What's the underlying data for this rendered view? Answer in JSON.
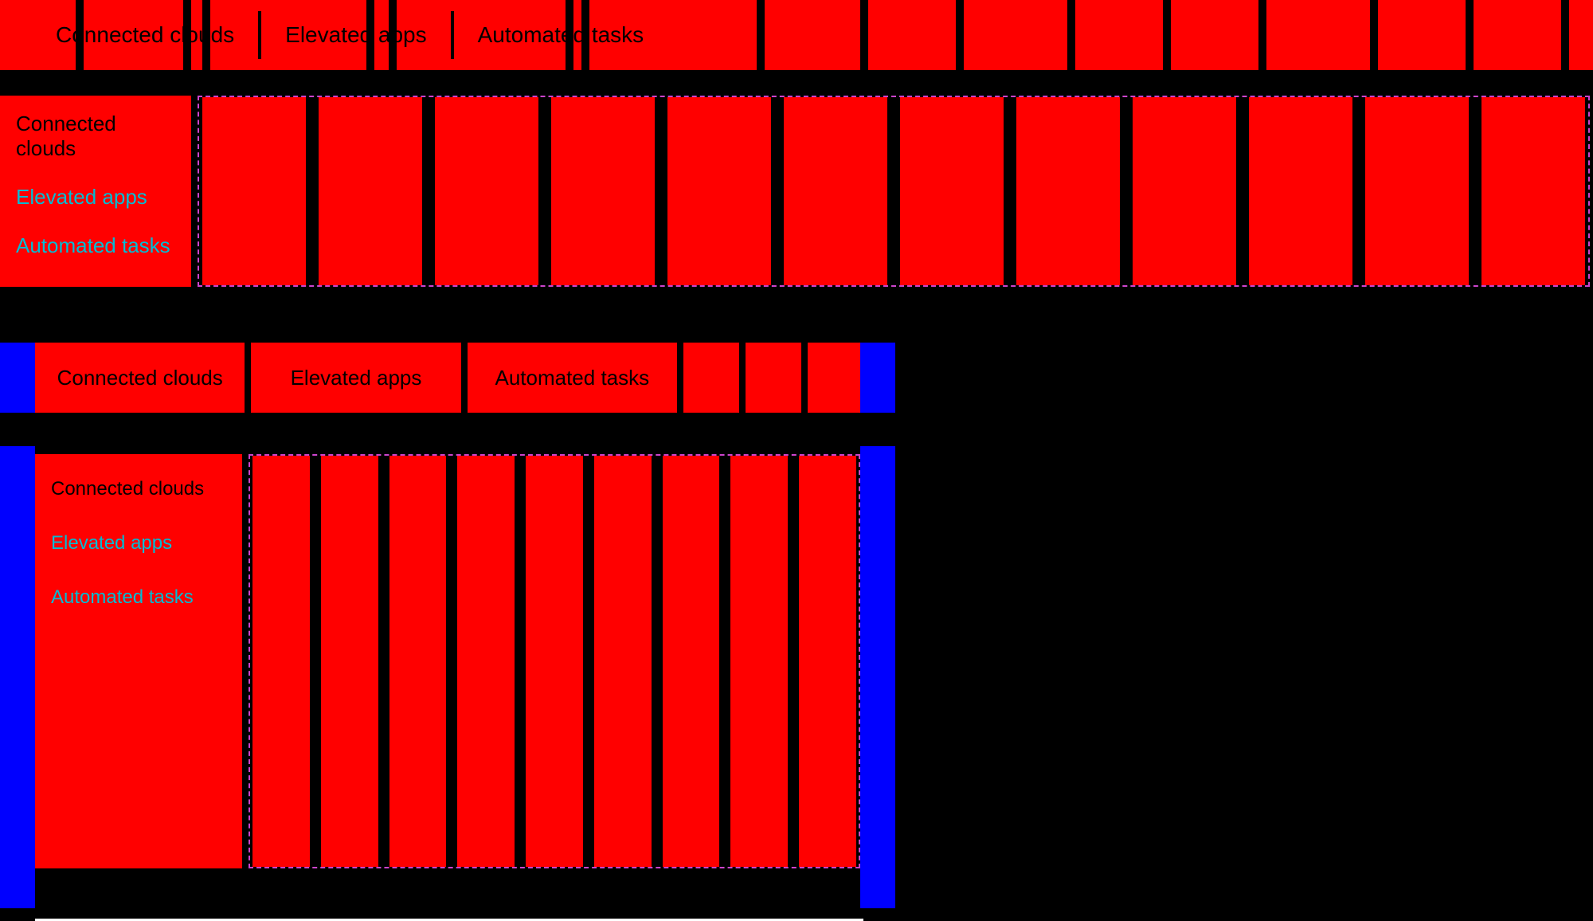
{
  "top_section": {
    "tabs": [
      {
        "label": "Connected clouds",
        "id": "connected-clouds"
      },
      {
        "label": "Elevated apps",
        "id": "elevated-apps"
      },
      {
        "label": "Automated tasks",
        "id": "automated-tasks"
      }
    ]
  },
  "dropdown_section": {
    "menu_items": [
      {
        "label": "Connected clouds",
        "style": "normal"
      },
      {
        "label": "Elevated apps",
        "style": "teal"
      },
      {
        "label": "Automated tasks",
        "style": "teal"
      }
    ]
  },
  "second_tabs_section": {
    "tabs": [
      {
        "label": "Connected clouds",
        "id": "connected-clouds-2"
      },
      {
        "label": "Elevated apps",
        "id": "elevated-apps-2"
      },
      {
        "label": "Automated tasks",
        "id": "automated-tasks-2"
      }
    ]
  },
  "second_dropdown_section": {
    "menu_items": [
      {
        "label": "Connected clouds",
        "style": "normal"
      },
      {
        "label": "Elevated apps",
        "style": "teal"
      },
      {
        "label": "Automated tasks",
        "style": "teal"
      }
    ]
  }
}
